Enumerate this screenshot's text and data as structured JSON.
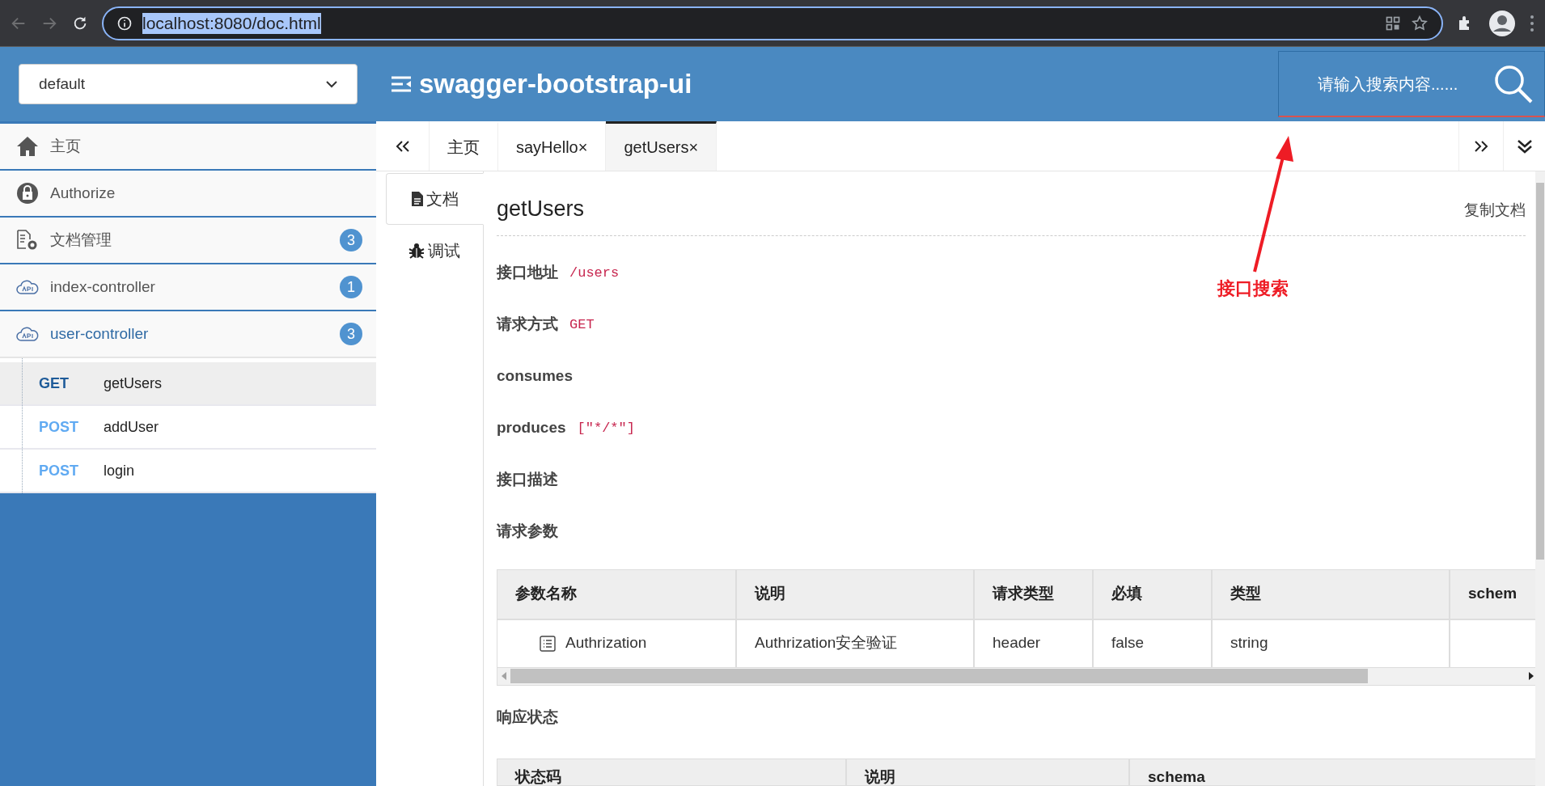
{
  "browser": {
    "url": "localhost:8080/doc.html"
  },
  "header": {
    "group_select": "default",
    "title": "swagger-bootstrap-ui",
    "search_placeholder": "请输入搜索内容......"
  },
  "sidebar": {
    "items": [
      {
        "kind": "home",
        "label": "主页"
      },
      {
        "kind": "lock",
        "label": "Authorize"
      },
      {
        "kind": "docs",
        "label": "文档管理",
        "count": "3"
      },
      {
        "kind": "api",
        "label": "index-controller",
        "count": "1",
        "expanded": false
      },
      {
        "kind": "api",
        "label": "user-controller",
        "count": "3",
        "expanded": true,
        "children": [
          {
            "method": "GET",
            "label": "getUsers",
            "selected": true
          },
          {
            "method": "POST",
            "label": "addUser",
            "selected": false
          },
          {
            "method": "POST",
            "label": "login",
            "selected": false
          }
        ]
      }
    ]
  },
  "tabs": [
    {
      "label": "主页",
      "closable": false,
      "selected": false
    },
    {
      "label": "sayHello",
      "closable": true,
      "selected": false
    },
    {
      "label": "getUsers",
      "closable": true,
      "selected": true
    }
  ],
  "tab_close": "×",
  "side_tabs": [
    {
      "kind": "doc",
      "label": "文档",
      "selected": true
    },
    {
      "kind": "debug",
      "label": "调试",
      "selected": false
    }
  ],
  "doc": {
    "title": "getUsers",
    "copy_link": "复制文档",
    "fields": [
      {
        "label": "接口地址",
        "value": "/users"
      },
      {
        "label": "请求方式",
        "value": "GET"
      },
      {
        "label": "consumes"
      },
      {
        "label": "produces",
        "value": "[\"*/*\"]"
      },
      {
        "label": "接口描述"
      },
      {
        "label": "请求参数"
      }
    ],
    "params_table": {
      "columns": [
        "参数名称",
        "说明",
        "请求类型",
        "必填",
        "类型",
        "schem"
      ],
      "rows": [
        [
          "Authrization",
          "Authrization安全验证",
          "header",
          "false",
          "string",
          ""
        ]
      ]
    },
    "response_heading": "响应状态",
    "response_table": {
      "columns": [
        "状态码",
        "说明",
        "schema"
      ]
    }
  },
  "annotation": {
    "label": "接口搜索"
  }
}
